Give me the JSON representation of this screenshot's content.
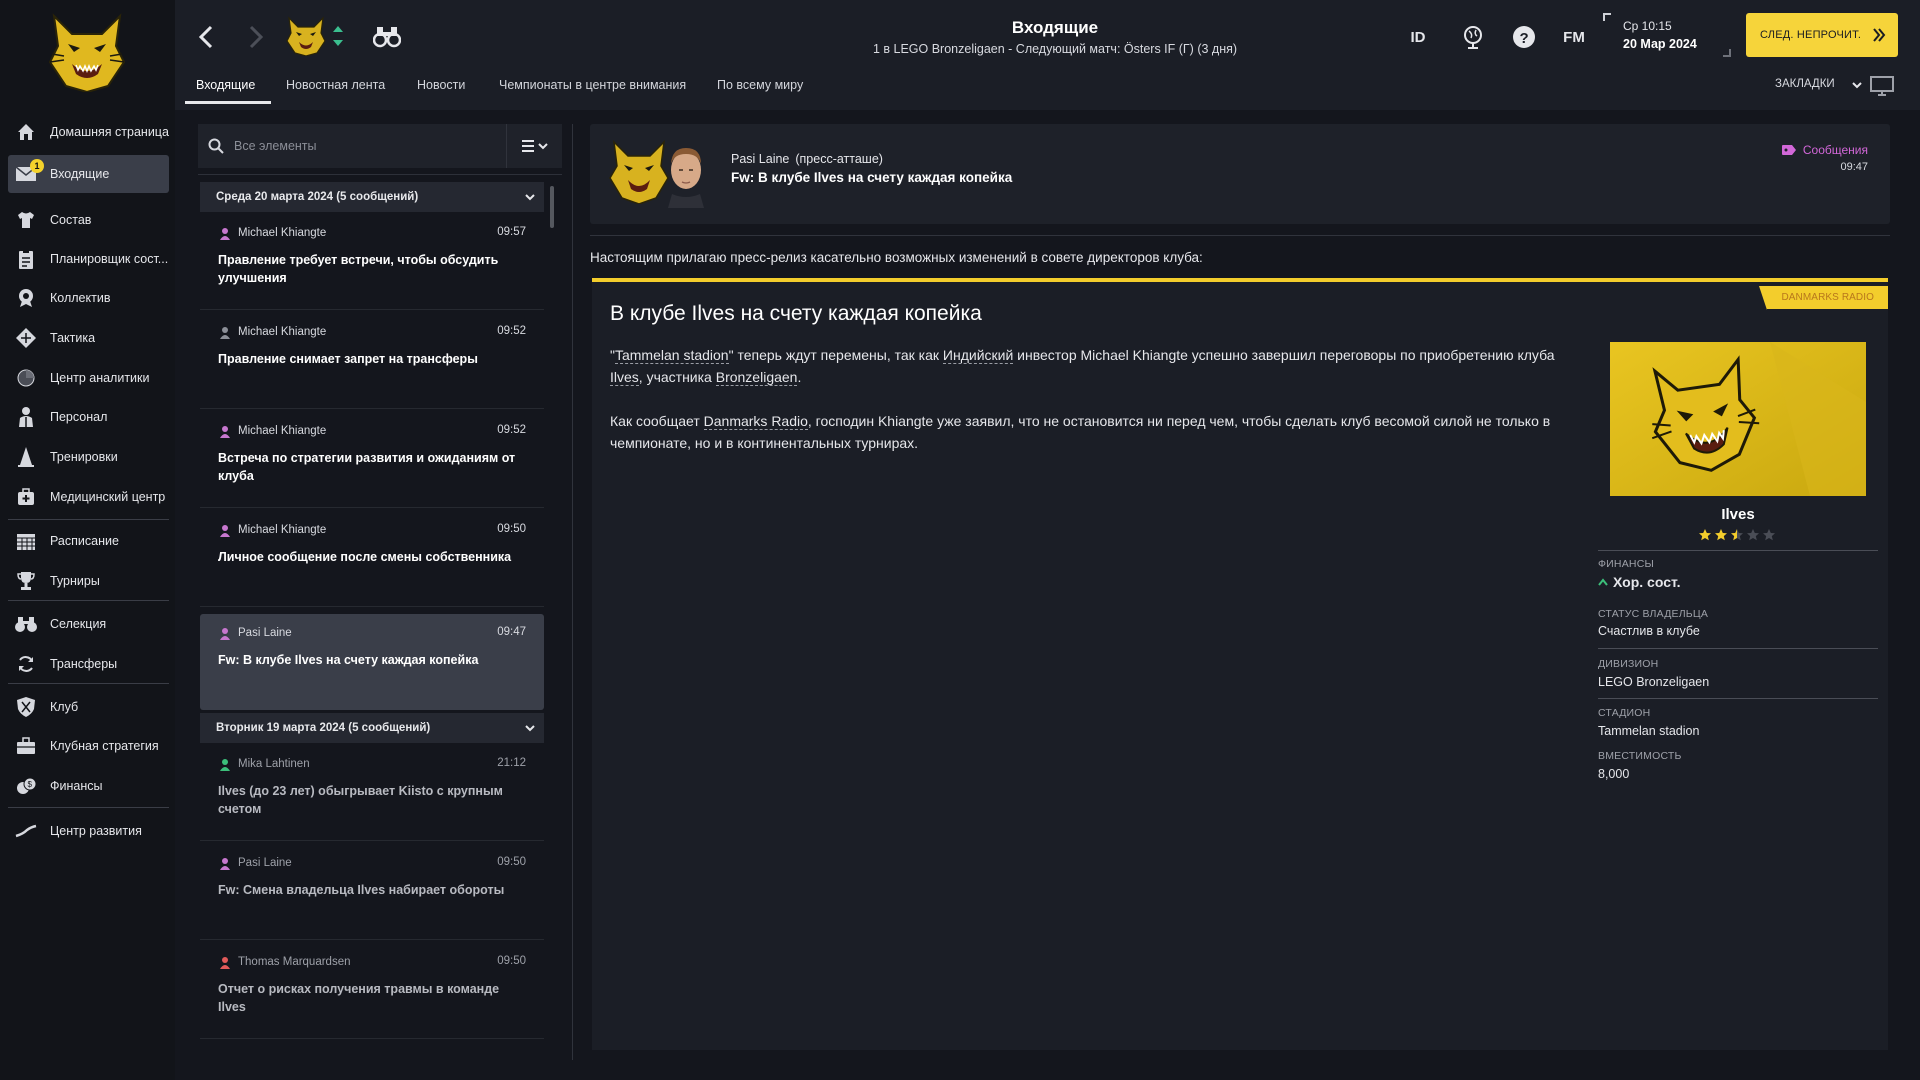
{
  "sidebar": {
    "items": [
      {
        "label": "Домашняя страница",
        "icon": "home-icon"
      },
      {
        "label": "Входящие",
        "icon": "inbox-icon",
        "badge": "1"
      },
      {
        "label": "Состав",
        "icon": "squad-shirt-icon"
      },
      {
        "label": "Планировщик сост...",
        "icon": "clipboard-icon"
      },
      {
        "label": "Коллектив",
        "icon": "dynamics-icon"
      },
      {
        "label": "Тактика",
        "icon": "tactics-icon"
      },
      {
        "label": "Центр аналитики",
        "icon": "analytics-icon"
      },
      {
        "label": "Персонал",
        "icon": "staff-icon"
      },
      {
        "label": "Тренировки",
        "icon": "training-cone-icon"
      },
      {
        "label": "Медицинский центр",
        "icon": "medical-icon"
      },
      {
        "label": "Расписание",
        "icon": "calendar-icon"
      },
      {
        "label": "Турниры",
        "icon": "trophy-icon"
      },
      {
        "label": "Селекция",
        "icon": "binoculars-icon"
      },
      {
        "label": "Трансферы",
        "icon": "transfers-icon"
      },
      {
        "label": "Клуб",
        "icon": "club-shield-icon"
      },
      {
        "label": "Клубная стратегия",
        "icon": "briefcase-icon"
      },
      {
        "label": "Финансы",
        "icon": "finances-icon"
      },
      {
        "label": "Центр развития",
        "icon": "development-icon"
      }
    ]
  },
  "header": {
    "title": "Входящие",
    "subtitle": "1 в LEGO Bronzeligaen - Следующий матч: Östers IF (Г) (3 дня)",
    "tabs": [
      "Входящие",
      "Новостная лента",
      "Новости",
      "Чемпионаты в центре внимания",
      "По всему миру"
    ],
    "id_label": "ID",
    "fm_label": "FM",
    "time": "Ср 10:15",
    "date": "20 Мар 2024",
    "continue_label": "СЛЕД. НЕПРОЧИТ.",
    "bookmarks_label": "ЗАКЛАДКИ",
    "accent": "#f6d43a"
  },
  "inbox": {
    "search_placeholder": "Все элементы",
    "groups": [
      {
        "title": "Среда 20 марта 2024 (5 сообщений)"
      },
      {
        "title": "Вторник 19 марта 2024 (5 сообщений)"
      }
    ],
    "messages": [
      {
        "sender": "Michael Khiangte",
        "time": "09:57",
        "subject": "Правление требует встречи, чтобы обсудить улучшения"
      },
      {
        "sender": "Michael Khiangte",
        "time": "09:52",
        "subject": "Правление снимает запрет на трансферы"
      },
      {
        "sender": "Michael Khiangte",
        "time": "09:52",
        "subject": "Встреча по стратегии развития и ожиданиям от клуба"
      },
      {
        "sender": "Michael Khiangte",
        "time": "09:50",
        "subject": "Личное сообщение после смены собственника"
      },
      {
        "sender": "Pasi Laine",
        "time": "09:47",
        "subject": "Fw: В клубе Ilves на счету каждая копейка"
      },
      {
        "sender": "Mika Lahtinen",
        "time": "21:12",
        "subject": "Ilves (до 23 лет) обыгрывает Kiisto с крупным счетом"
      },
      {
        "sender": "Pasi Laine",
        "time": "09:50",
        "subject": "Fw: Смена владельца Ilves набирает обороты"
      },
      {
        "sender": "Thomas Marquardsen",
        "time": "09:50",
        "subject": "Отчет о рисках получения травмы в команде Ilves"
      }
    ]
  },
  "detail": {
    "sender": "Pasi Laine",
    "role": "(пресс-атташе)",
    "subject": "Fw: В клубе Ilves на счету каждая копейка",
    "messages_label": "Сообщения",
    "time": "09:47",
    "intro": "Настоящим прилагаю пресс-релиз касательно возможных изменений в совете директоров клуба:"
  },
  "article": {
    "source": "DANMARKS RADIO",
    "title": "В клубе Ilves на счету каждая копейка",
    "p1": {
      "a": "\"",
      "stadium": "Tammelan stadion",
      "b": "\" теперь ждут перемены, так как ",
      "nationality": "Индийский",
      "c": " инвестор Michael Khiangte успешно завершил переговоры по приобретению клуба ",
      "club": "Ilves",
      "d": ", участника ",
      "league": "Bronzeligaen",
      "e": "."
    },
    "p2": {
      "a": "Как сообщает ",
      "source": "Danmarks Radio",
      "b": ", господин Khiangte уже заявил, что не остановится ни перед чем, чтобы сделать клуб весомой силой не только в чемпионате, но и в континентальных турнирах."
    }
  },
  "club_card": {
    "name": "Ilves",
    "stars": 2.5,
    "stars_max": 5,
    "finances_label": "ФИНАНСЫ",
    "finances_value": "Хор. сост.",
    "owner_label": "СТАТУС ВЛАДЕЛЬЦА",
    "owner_value": "Счастлив в клубе",
    "division_label": "ДИВИЗИОН",
    "division_value": "LEGO Bronzeligaen",
    "stadium_label": "СТАДИОН",
    "stadium_value": "Tammelan stadion",
    "capacity_label": "ВМЕСТИМОСТЬ",
    "capacity_value": "8,000"
  }
}
